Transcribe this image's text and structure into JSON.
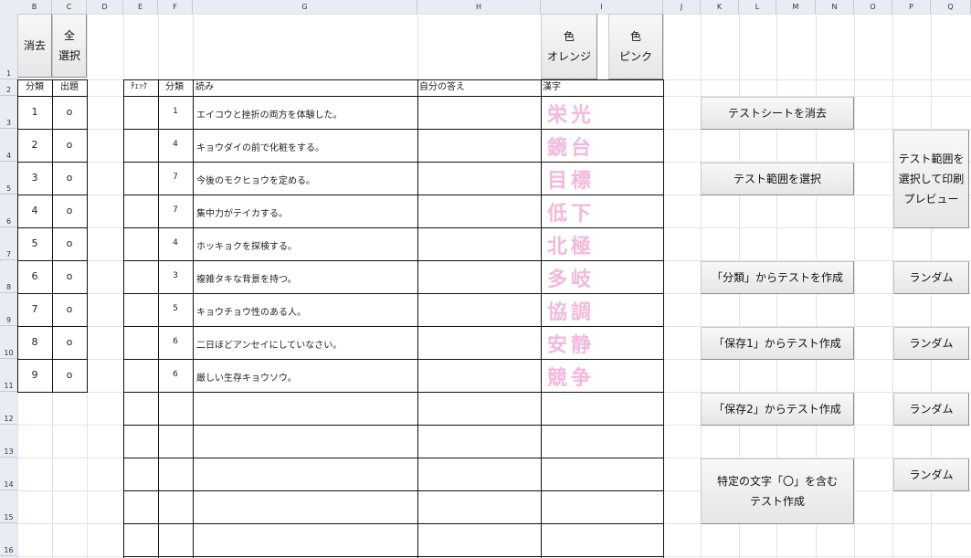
{
  "columns": [
    "B",
    "C",
    "D",
    "E",
    "F",
    "G",
    "H",
    "I",
    "J",
    "K",
    "L",
    "M",
    "N",
    "O",
    "P",
    "Q"
  ],
  "rows": [
    "1",
    "2",
    "3",
    "4",
    "5",
    "6",
    "7",
    "8",
    "9",
    "10",
    "11",
    "12",
    "13",
    "14",
    "15",
    "16"
  ],
  "top_buttons": {
    "erase": "消去",
    "select_all": "全\n選択",
    "color_orange": "色\nオレンジ",
    "color_pink": "色\nピンク"
  },
  "headers": {
    "bunrui_left": "分類",
    "shutsudai": "出題",
    "check": "ﾁｪｯｸ",
    "bunrui": "分類",
    "yomi": "読み",
    "answer": "自分の答え",
    "kanji": "漢字"
  },
  "rows_data": [
    {
      "num": "1",
      "mark": "o",
      "cat": "1",
      "reading": "エイコウと挫折の両方を体験した。",
      "kanji": "栄光"
    },
    {
      "num": "2",
      "mark": "o",
      "cat": "4",
      "reading": "キョウダイの前で化粧をする。",
      "kanji": "鏡台"
    },
    {
      "num": "3",
      "mark": "o",
      "cat": "7",
      "reading": "今後のモクヒョウを定める。",
      "kanji": "目標"
    },
    {
      "num": "4",
      "mark": "o",
      "cat": "7",
      "reading": "集中力がテイカする。",
      "kanji": "低下"
    },
    {
      "num": "5",
      "mark": "o",
      "cat": "4",
      "reading": "ホッキョクを探検する。",
      "kanji": "北極"
    },
    {
      "num": "6",
      "mark": "o",
      "cat": "3",
      "reading": "複雑タキな背景を持つ。",
      "kanji": "多岐"
    },
    {
      "num": "7",
      "mark": "o",
      "cat": "5",
      "reading": "キョウチョウ性のある人。",
      "kanji": "協調"
    },
    {
      "num": "8",
      "mark": "o",
      "cat": "6",
      "reading": "二日ほどアンセイにしていなさい。",
      "kanji": "安静"
    },
    {
      "num": "9",
      "mark": "o",
      "cat": "6",
      "reading": "厳しい生存キョウソウ。",
      "kanji": "競争"
    }
  ],
  "side_buttons": {
    "erase_sheet": "テストシートを消去",
    "select_range": "テスト範囲を選択",
    "select_print": "テスト範囲を\n選択して印刷\nプレビュー",
    "from_category": "「分類」からテストを作成",
    "from_save1": "「保存1」からテスト作成",
    "from_save2": "「保存2」からテスト作成",
    "specific_char": "特定の文字「〇」を含む\nテスト作成",
    "random1": "ランダム",
    "random2": "ランダム",
    "random3": "ランダム",
    "random4": "ランダム"
  }
}
